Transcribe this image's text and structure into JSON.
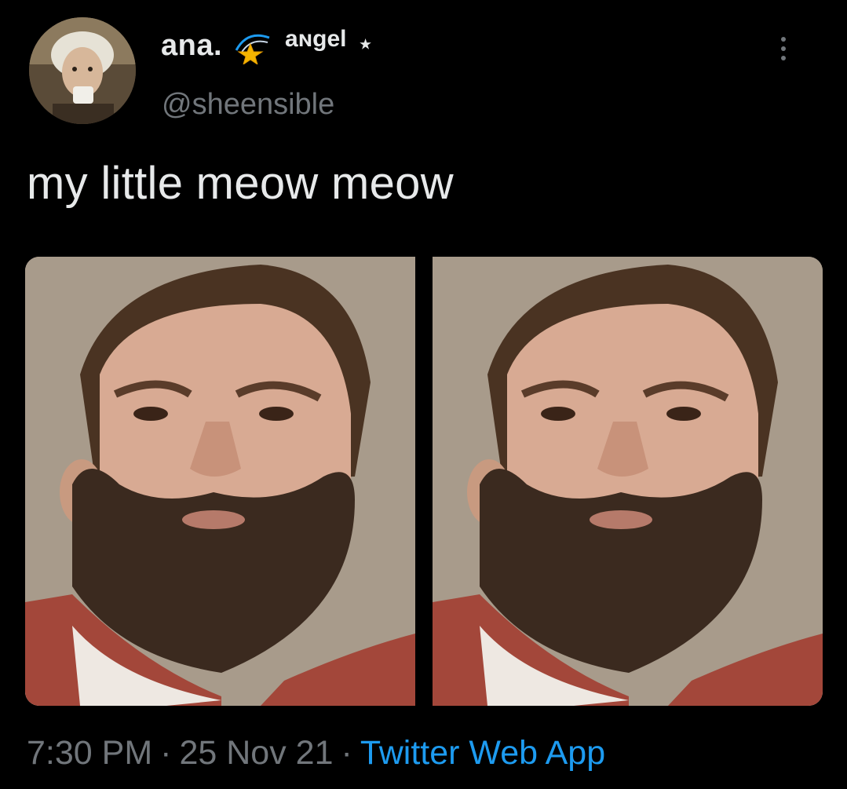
{
  "user": {
    "display_name": "ana.",
    "name_suffix": "aɴgel",
    "name_star": "⭑",
    "handle": "@sheensible",
    "avatar_icon": "profile-avatar"
  },
  "tweet": {
    "text": "my little meow meow",
    "time": "7:30 PM",
    "date": "25 Nov 21",
    "separator": "·",
    "source": "Twitter Web App"
  },
  "colors": {
    "background": "#000000",
    "text_primary": "#e7e9ea",
    "text_secondary": "#71767b",
    "link": "#1d9bf0"
  },
  "media": {
    "count": 2,
    "items": [
      {
        "icon": "photo-bearded-man"
      },
      {
        "icon": "photo-bearded-man"
      }
    ]
  }
}
